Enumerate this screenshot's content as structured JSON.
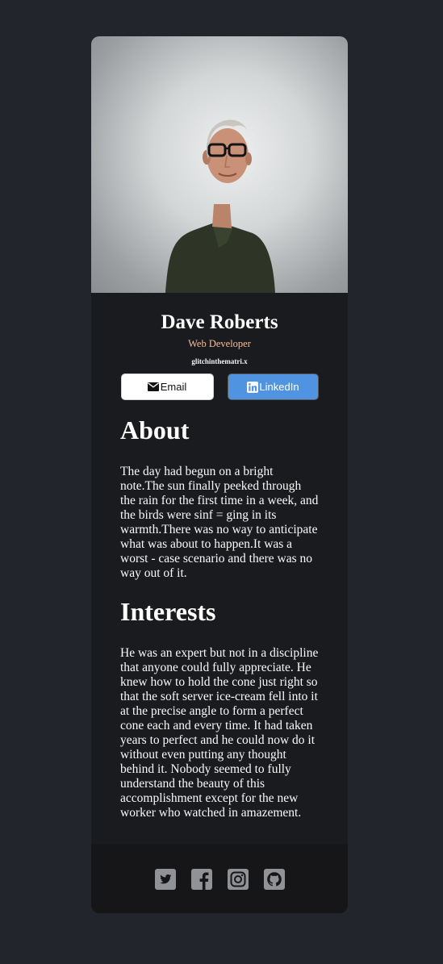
{
  "profile": {
    "name": "Dave Roberts",
    "title": "Web Developer",
    "website": "glitchinthematri.x"
  },
  "buttons": {
    "email_label": "Email",
    "email_icon": "envelope-icon",
    "linkedin_label": "LinkedIn",
    "linkedin_icon": "linkedin-icon"
  },
  "about": {
    "heading": "About",
    "text": "The day had begun on a bright note.The sun finally peeked through the rain for the first time in a week, and the birds were sinf = ging in its warmth.There was no way to anticipate what was about to happen.It was a worst - case scenario and there was no way out of it."
  },
  "interests": {
    "heading": "Interests",
    "text": "He was an expert but not in a discipline that anyone could fully appreciate. He knew how to hold the cone just right so that the soft server ice-cream fell into it at the precise angle to form a perfect cone each and every time. It had taken years to perfect and he could now do it without even putting any thought behind it. Nobody seemed to fully understand the beauty of this accomplishment except for the new worker who watched in amazement."
  },
  "footer": {
    "icons": [
      "twitter-icon",
      "facebook-icon",
      "instagram-icon",
      "github-icon"
    ]
  },
  "colors": {
    "page_background": "#23252c",
    "card_background": "#1a1b1f",
    "footer_background": "#161618",
    "accent_title": "#f3bf99",
    "linkedin_blue": "#5093e1",
    "social_icon": "#909296"
  }
}
